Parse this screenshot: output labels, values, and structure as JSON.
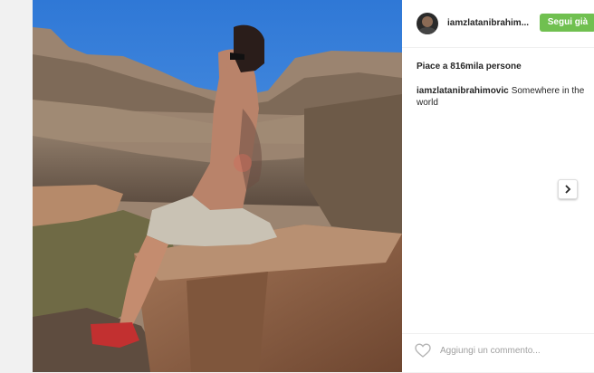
{
  "post": {
    "username": "iamzlatanibrahim...",
    "follow_label": "Segui già",
    "likes_text": "Piace a 816mila persone",
    "caption_user": "iamzlatanibrahimovic",
    "caption_text": "Somewhere in the world"
  },
  "comment": {
    "placeholder": "Aggiungi un commento..."
  },
  "icons": {
    "like": "heart-icon",
    "next": "chevron-right-icon"
  },
  "colors": {
    "follow_button": "#70c050",
    "sky": "#3f86d8"
  }
}
